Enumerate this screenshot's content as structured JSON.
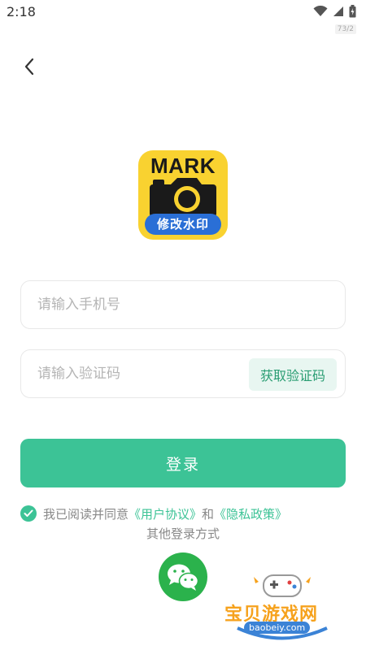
{
  "status": {
    "time": "2:18",
    "badge": "73/2"
  },
  "logo": {
    "mark": "MARK",
    "band": "修改水印"
  },
  "phone": {
    "placeholder": "请输入手机号"
  },
  "code": {
    "placeholder": "请输入验证码",
    "button": "获取验证码"
  },
  "login": {
    "label": "登录"
  },
  "agreement": {
    "checked": true,
    "prefix": "我已阅读并同意",
    "user_agreement": "《用户协议》",
    "and": "和",
    "privacy_policy": "《隐私政策》"
  },
  "other_login": {
    "title": "其他登录方式",
    "wechat": "wechat-icon"
  },
  "watermark": {
    "text": "宝贝游戏网",
    "url": "baobeiy.com"
  },
  "colors": {
    "accent": "#3cc396",
    "logo_yellow": "#f9d230",
    "logo_blue": "#2a6fd6",
    "wechat": "#2bb24c"
  }
}
